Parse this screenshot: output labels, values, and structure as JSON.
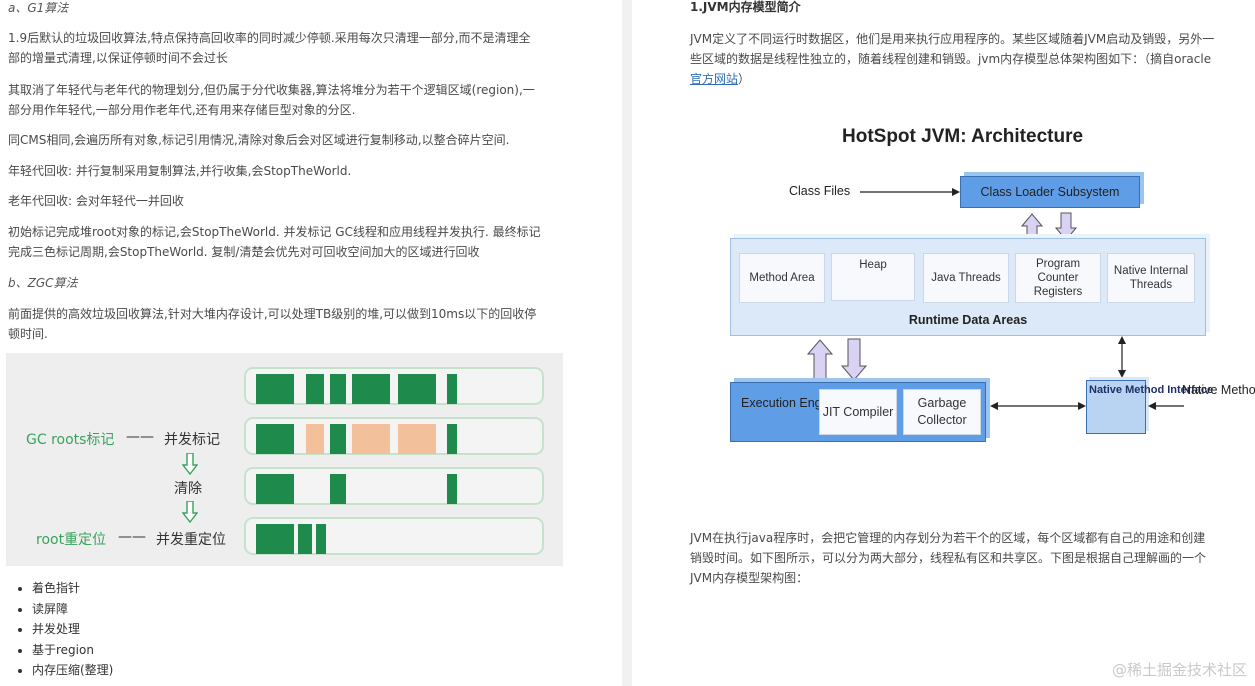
{
  "left": {
    "heading_g1": "a、G1算法",
    "para1_l1": "1.9后默认的垃圾回收算法,特点保持高回收率的同时减少停顿.采用每次只清理一部分,而不是清理全",
    "para1_l2": "部的增量式清理,以保证停顿时间不会过长",
    "para2_l1": "其取消了年轻代与老年代的物理划分,但仍属于分代收集器,算法将堆分为若干个逻辑区域(region),一",
    "para2_l2": "部分用作年轻代,一部分用作老年代,还有用来存储巨型对象的分区.",
    "para3": "同CMS相同,会遍历所有对象,标记引用情况,清除对象后会对区域进行复制移动,以整合碎片空间.",
    "para4": "年轻代回收: 并行复制采用复制算法,并行收集,会StopTheWorld.",
    "para5": "老年代回收: 会对年轻代一并回收",
    "para6_l1": "初始标记完成堆root对象的标记,会StopTheWorld. 并发标记 GC线程和应用线程并发执行. 最终标记",
    "para6_l2": "完成三色标记周期,会StopTheWorld. 复制/清楚会优先对可回收空间加大的区域进行回收",
    "heading_zgc": "b、ZGC算法",
    "para7_l1": "前面提供的高效垃圾回收算法,针对大堆内存设计,可以处理TB级别的堆,可以做到10ms以下的回收停",
    "para7_l2": "顿时间.",
    "figure": {
      "gc_roots_label": "GC roots标记",
      "concurrent_mark": "并发标记",
      "clear": "清除",
      "root_relocate_label": "root重定位",
      "concurrent_relocate": "并发重定位",
      "dash": "——"
    },
    "bullets": [
      "着色指针",
      "读屏障",
      "并发处理",
      "基于region",
      "内存压缩(整理)"
    ]
  },
  "right": {
    "heading": "1.JVM内存模型简介",
    "para1_l1": "JVM定义了不同运行时数据区，他们是用来执行应用程序的。某些区域随着JVM启动及销毁，另外一",
    "para1_l2": "些区域的数据是线程性独立的，随着线程创建和销毁。jvm内存模型总体架构图如下：（摘自oracle",
    "link_text": "官方网站",
    "link_after": "）",
    "diagram": {
      "title": "HotSpot JVM: Architecture",
      "class_files": "Class Files",
      "class_loader": "Class Loader Subsystem",
      "areas": [
        "Method Area",
        "Heap",
        "Java Threads",
        "Program Counter Registers",
        "Native Internal Threads"
      ],
      "runtime_label": "Runtime Data Areas",
      "exec_engine": "Execution Engine",
      "jit": "JIT Compiler",
      "gc": "Garbage Collector",
      "native_interface": "Native Method Interface",
      "native_libraries": "Native Method Libraries"
    },
    "para2_l1": "JVM在执行java程序时，会把它管理的内存划分为若干个的区域，每个区域都有自己的用途和创建",
    "para2_l2": "销毁时间。如下图所示，可以分为两大部分，线程私有区和共享区。下图是根据自己理解画的一个",
    "para2_l3": "JVM内存模型架构图："
  },
  "watermark": "@稀土掘金技术社区",
  "colors": {
    "green": "#1e8a4c",
    "orange": "#f3c09c",
    "box_blue": "#5f9ee6",
    "arrow_fill": "#d9d2f2"
  }
}
